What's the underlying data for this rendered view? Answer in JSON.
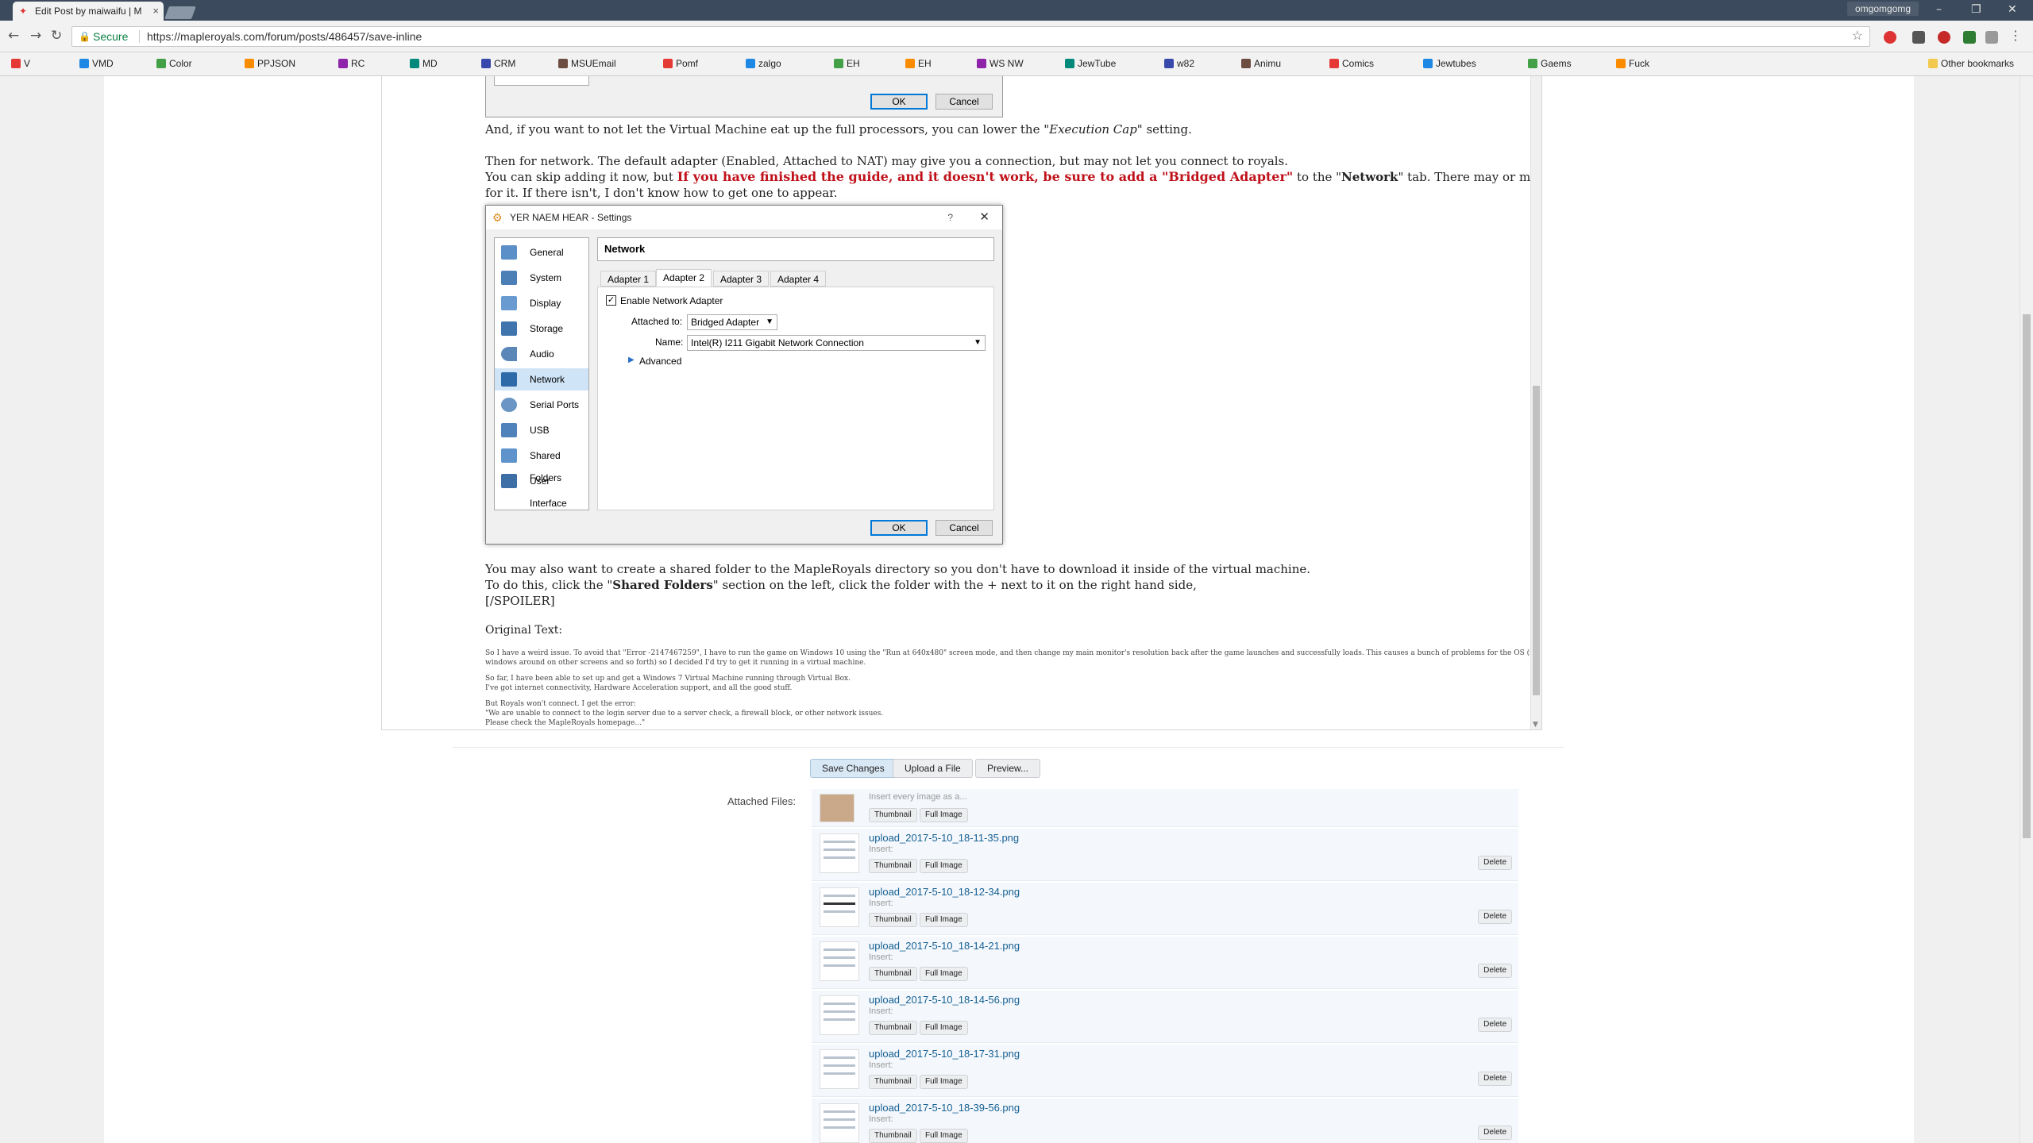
{
  "browser": {
    "tab_title": "Edit Post by maiwaifu | M",
    "profile_name": "omgomgomg",
    "secure_label": "Secure",
    "url": "https://mapleroyals.com/forum/posts/486457/save-inline",
    "bookmarks": [
      "V",
      "VMD",
      "Color",
      "PPJSON",
      "RC",
      "MD",
      "CRM",
      "MSUEmail",
      "Pomf",
      "zalgo",
      "EH",
      "EH",
      "WS NW",
      "JewTube",
      "w82",
      "Animu",
      "Comics",
      "Jewtubes",
      "Gaems",
      "Fuck"
    ],
    "other_bookmarks": "Other bookmarks"
  },
  "colors": {
    "tabbar": "#3b4a5c",
    "accent_red": "#c0121b",
    "link": "#176093"
  },
  "post": {
    "exec_cap_pre": "And, if you want to not let the Virtual Machine eat up the full processors, you can lower the \"",
    "exec_cap_em": "Execution Cap",
    "exec_cap_post": "\" setting.",
    "network_1": "Then for network. The default adapter (Enabled, Attached to NAT) may give you a connection, but may not let you connect to royals.",
    "network_2_pre": "You can skip adding it now, but ",
    "network_2_red": "If you have finished the guide, and it doesn't work, be sure to add a \"Bridged Adapter\"",
    "network_2_mid": " to the \"",
    "network_2_bold": "Network",
    "network_2_post": "\" tab. There may or may not be an option",
    "network_3": "for it. If there isn't, I don't know how to get one to appear.",
    "shared_1": "You may also want to create a shared folder to the MapleRoyals directory so you don't have to download it inside of the virtual machine.",
    "shared_2_pre": "To do this, click the \"",
    "shared_2_bold": "Shared Folders",
    "shared_2_post": "\" section on the left, click the folder with the + next to it on the right hand side,",
    "spoiler_close": "[/SPOILER]",
    "original_label": "Original Text:",
    "orig_1": "So I have a weird issue. To avoid that \"Error -2147467259\", I have to run the game on Windows 10 using the \"Run at 640x480\" screen mode, and then change my main monitor's resolution back after the game launches and successfully loads. This causes a bunch of problems for the OS (moving",
    "orig_2": "windows around on other screens and so forth) so I decided I'd try to get it running in a virtual machine.",
    "orig_3": "So far, I have been able to set up and get a Windows 7 Virtual Machine running through Virtual Box.",
    "orig_4": "I've got internet connectivity, Hardware Acceleration support, and all the good stuff.",
    "orig_5": "But Royals won't connect. I get the error:",
    "orig_6": "\"We are unable to connect to the login server due to a server check, a firewall block, or other network issues.",
    "orig_7": "Please check the MapleRoyals homepage...\""
  },
  "dialog_top": {
    "ok": "OK",
    "cancel": "Cancel"
  },
  "dialog": {
    "title": "YER NAEM HEAR - Settings",
    "help": "?",
    "close": "✕",
    "sidebar": [
      "General",
      "System",
      "Display",
      "Storage",
      "Audio",
      "Network",
      "Serial Ports",
      "USB",
      "Shared Folders",
      "User Interface"
    ],
    "section_title": "Network",
    "tabs": [
      "Adapter 1",
      "Adapter 2",
      "Adapter 3",
      "Adapter 4"
    ],
    "enable_label": "Enable Network Adapter",
    "attached_label": "Attached to:",
    "attached_value": "Bridged Adapter",
    "name_label": "Name:",
    "name_value": "Intel(R) I211 Gigabit Network Connection",
    "advanced_label": "Advanced",
    "ok": "OK",
    "cancel": "Cancel"
  },
  "form": {
    "save": "Save Changes",
    "upload": "Upload a File",
    "preview": "Preview...",
    "attached_label": "Attached Files:",
    "first_insert": "Insert every image as a...",
    "thumbnail": "Thumbnail",
    "full_image": "Full Image",
    "insert": "Insert:",
    "delete": "Delete",
    "files": [
      "upload_2017-5-10_18-11-35.png",
      "upload_2017-5-10_18-12-34.png",
      "upload_2017-5-10_18-14-21.png",
      "upload_2017-5-10_18-14-56.png",
      "upload_2017-5-10_18-17-31.png",
      "upload_2017-5-10_18-39-56.png"
    ]
  }
}
